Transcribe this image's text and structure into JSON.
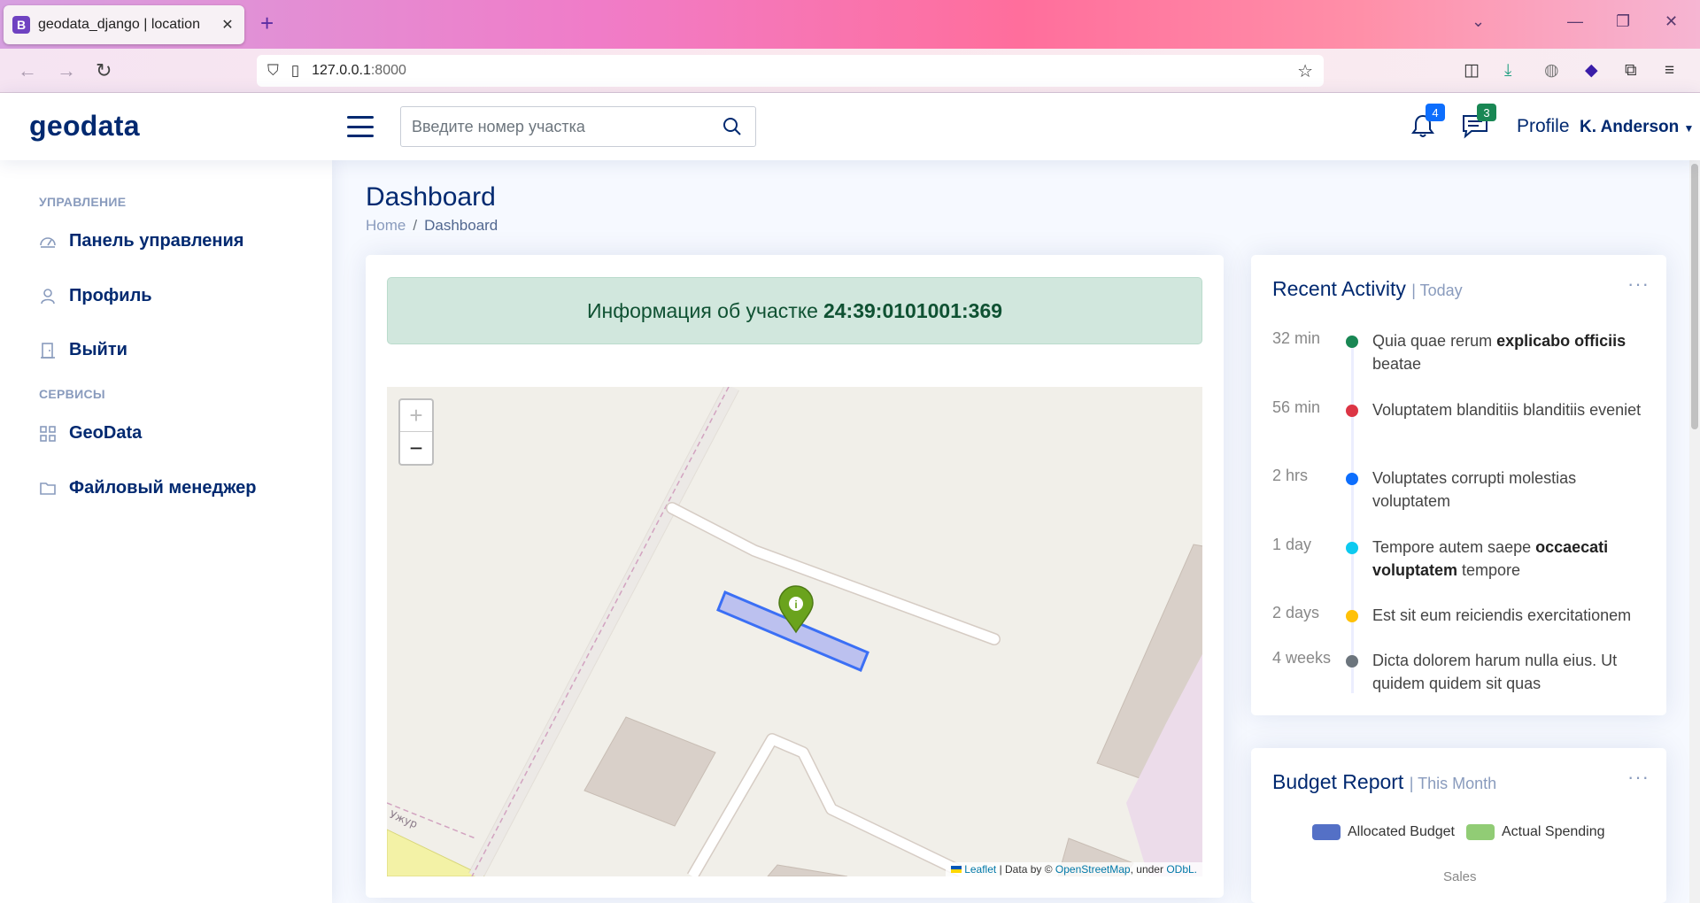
{
  "browser": {
    "tab_title": "geodata_django | location",
    "tab_icon_letter": "B",
    "url_host": "127.0.0.1",
    "url_port": ":8000"
  },
  "header": {
    "logo": "geodata",
    "search_placeholder": "Введите номер участка",
    "notifications_count": "4",
    "messages_count": "3",
    "profile_label": "Profile",
    "profile_name": "K. Anderson"
  },
  "sidebar": {
    "section_management": "УПРАВЛЕНИЕ",
    "items_management": [
      {
        "label": "Панель управления",
        "icon": "dashboard-gauge-icon"
      },
      {
        "label": "Профиль",
        "icon": "person-icon"
      },
      {
        "label": "Выйти",
        "icon": "door-exit-icon"
      }
    ],
    "section_services": "СЕРВИСЫ",
    "items_services": [
      {
        "label": "GeoData",
        "icon": "grid-icon"
      },
      {
        "label": "Файловый менеджер",
        "icon": "folder-icon"
      }
    ]
  },
  "main": {
    "page_title": "Dashboard",
    "breadcrumb": {
      "home": "Home",
      "separator": "/",
      "current": "Dashboard"
    },
    "alert_prefix": "Информация об участке",
    "parcel_number": "24:39:0101001:369",
    "map": {
      "zoom_in": "+",
      "zoom_out": "−",
      "street_label": "Ужур",
      "attribution_leaflet": "Leaflet",
      "attribution_mid": "| Data by ©",
      "attribution_osm": "OpenStreetMap",
      "attribution_under": ", under",
      "attribution_odbl": "ODbL."
    }
  },
  "recent_activity": {
    "title": "Recent Activity",
    "period": "| Today",
    "items": [
      {
        "time": "32 min",
        "color": "#198754",
        "pre": "Quia quae rerum ",
        "bold": "explicabo officiis",
        "post": " beatae"
      },
      {
        "time": "56 min",
        "color": "#dc3545",
        "pre": "Voluptatem blanditiis blanditiis eveniet",
        "bold": "",
        "post": ""
      },
      {
        "time": "2 hrs",
        "color": "#0d6efd",
        "pre": "Voluptates corrupti molestias voluptatem",
        "bold": "",
        "post": ""
      },
      {
        "time": "1 day",
        "color": "#0dcaf0",
        "pre": "Tempore autem saepe ",
        "bold": "occaecati voluptatem",
        "post": " tempore"
      },
      {
        "time": "2 days",
        "color": "#ffc107",
        "pre": "Est sit eum reiciendis exercitationem",
        "bold": "",
        "post": ""
      },
      {
        "time": "4 weeks",
        "color": "#6c757d",
        "pre": "Dicta dolorem harum nulla eius. Ut quidem quidem sit quas",
        "bold": "",
        "post": ""
      }
    ]
  },
  "budget_report": {
    "title": "Budget Report",
    "period": "| This Month",
    "legend": [
      {
        "label": "Allocated Budget",
        "color": "#5470c6"
      },
      {
        "label": "Actual Spending",
        "color": "#91cc75"
      }
    ],
    "chart_label": "Sales"
  },
  "colors": {
    "brand": "#012970",
    "muted": "#899bbd",
    "alert_bg": "#d1e7dd",
    "marker": "#6aa31d",
    "parcel_fill": "#aab2f0",
    "parcel_stroke": "#3b6ff5"
  }
}
